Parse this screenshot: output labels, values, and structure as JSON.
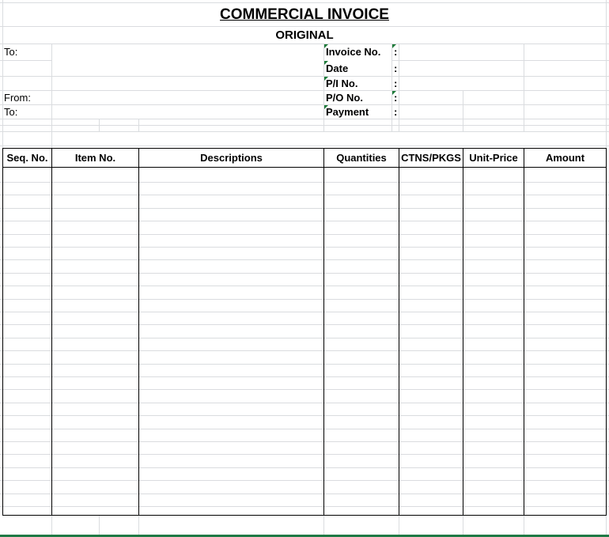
{
  "invoice": {
    "title": "COMMERCIAL INVOICE",
    "subtitle": "ORIGINAL"
  },
  "parties": {
    "to_label": "To:",
    "from_label": "From:",
    "to_label_2": "To:"
  },
  "details": [
    {
      "label": "Invoice No.",
      "colon": ":"
    },
    {
      "label": "Date",
      "colon": ":"
    },
    {
      "label": "P/I  No.",
      "colon": ":"
    },
    {
      "label": "P/O No.",
      "colon": ":"
    },
    {
      "label": "Payment",
      "colon": ":"
    }
  ],
  "table": {
    "headers": [
      "Seq. No.",
      "Item No.",
      "Descriptions",
      "Quantities",
      "CTNS/PKGS",
      "Unit-Price",
      "Amount"
    ]
  },
  "colors": {
    "gridline": "#dadcdf",
    "border": "#000000",
    "error_marker": "#1e7b3a",
    "selection": "#1f7a45"
  }
}
